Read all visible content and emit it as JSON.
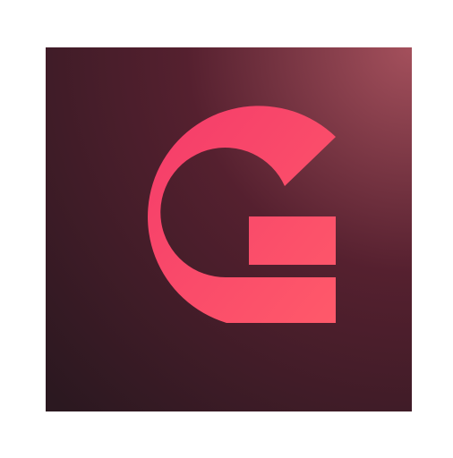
{
  "app_icon": {
    "name": "app-logo-icon",
    "shape": "stylized letter G",
    "colors": {
      "tile_dark": "#2b1820",
      "tile_mid": "#55202f",
      "tile_highlight": "#a4505c",
      "glyph_start": "#f43b6a",
      "glyph_end": "#ff5a6a"
    }
  }
}
